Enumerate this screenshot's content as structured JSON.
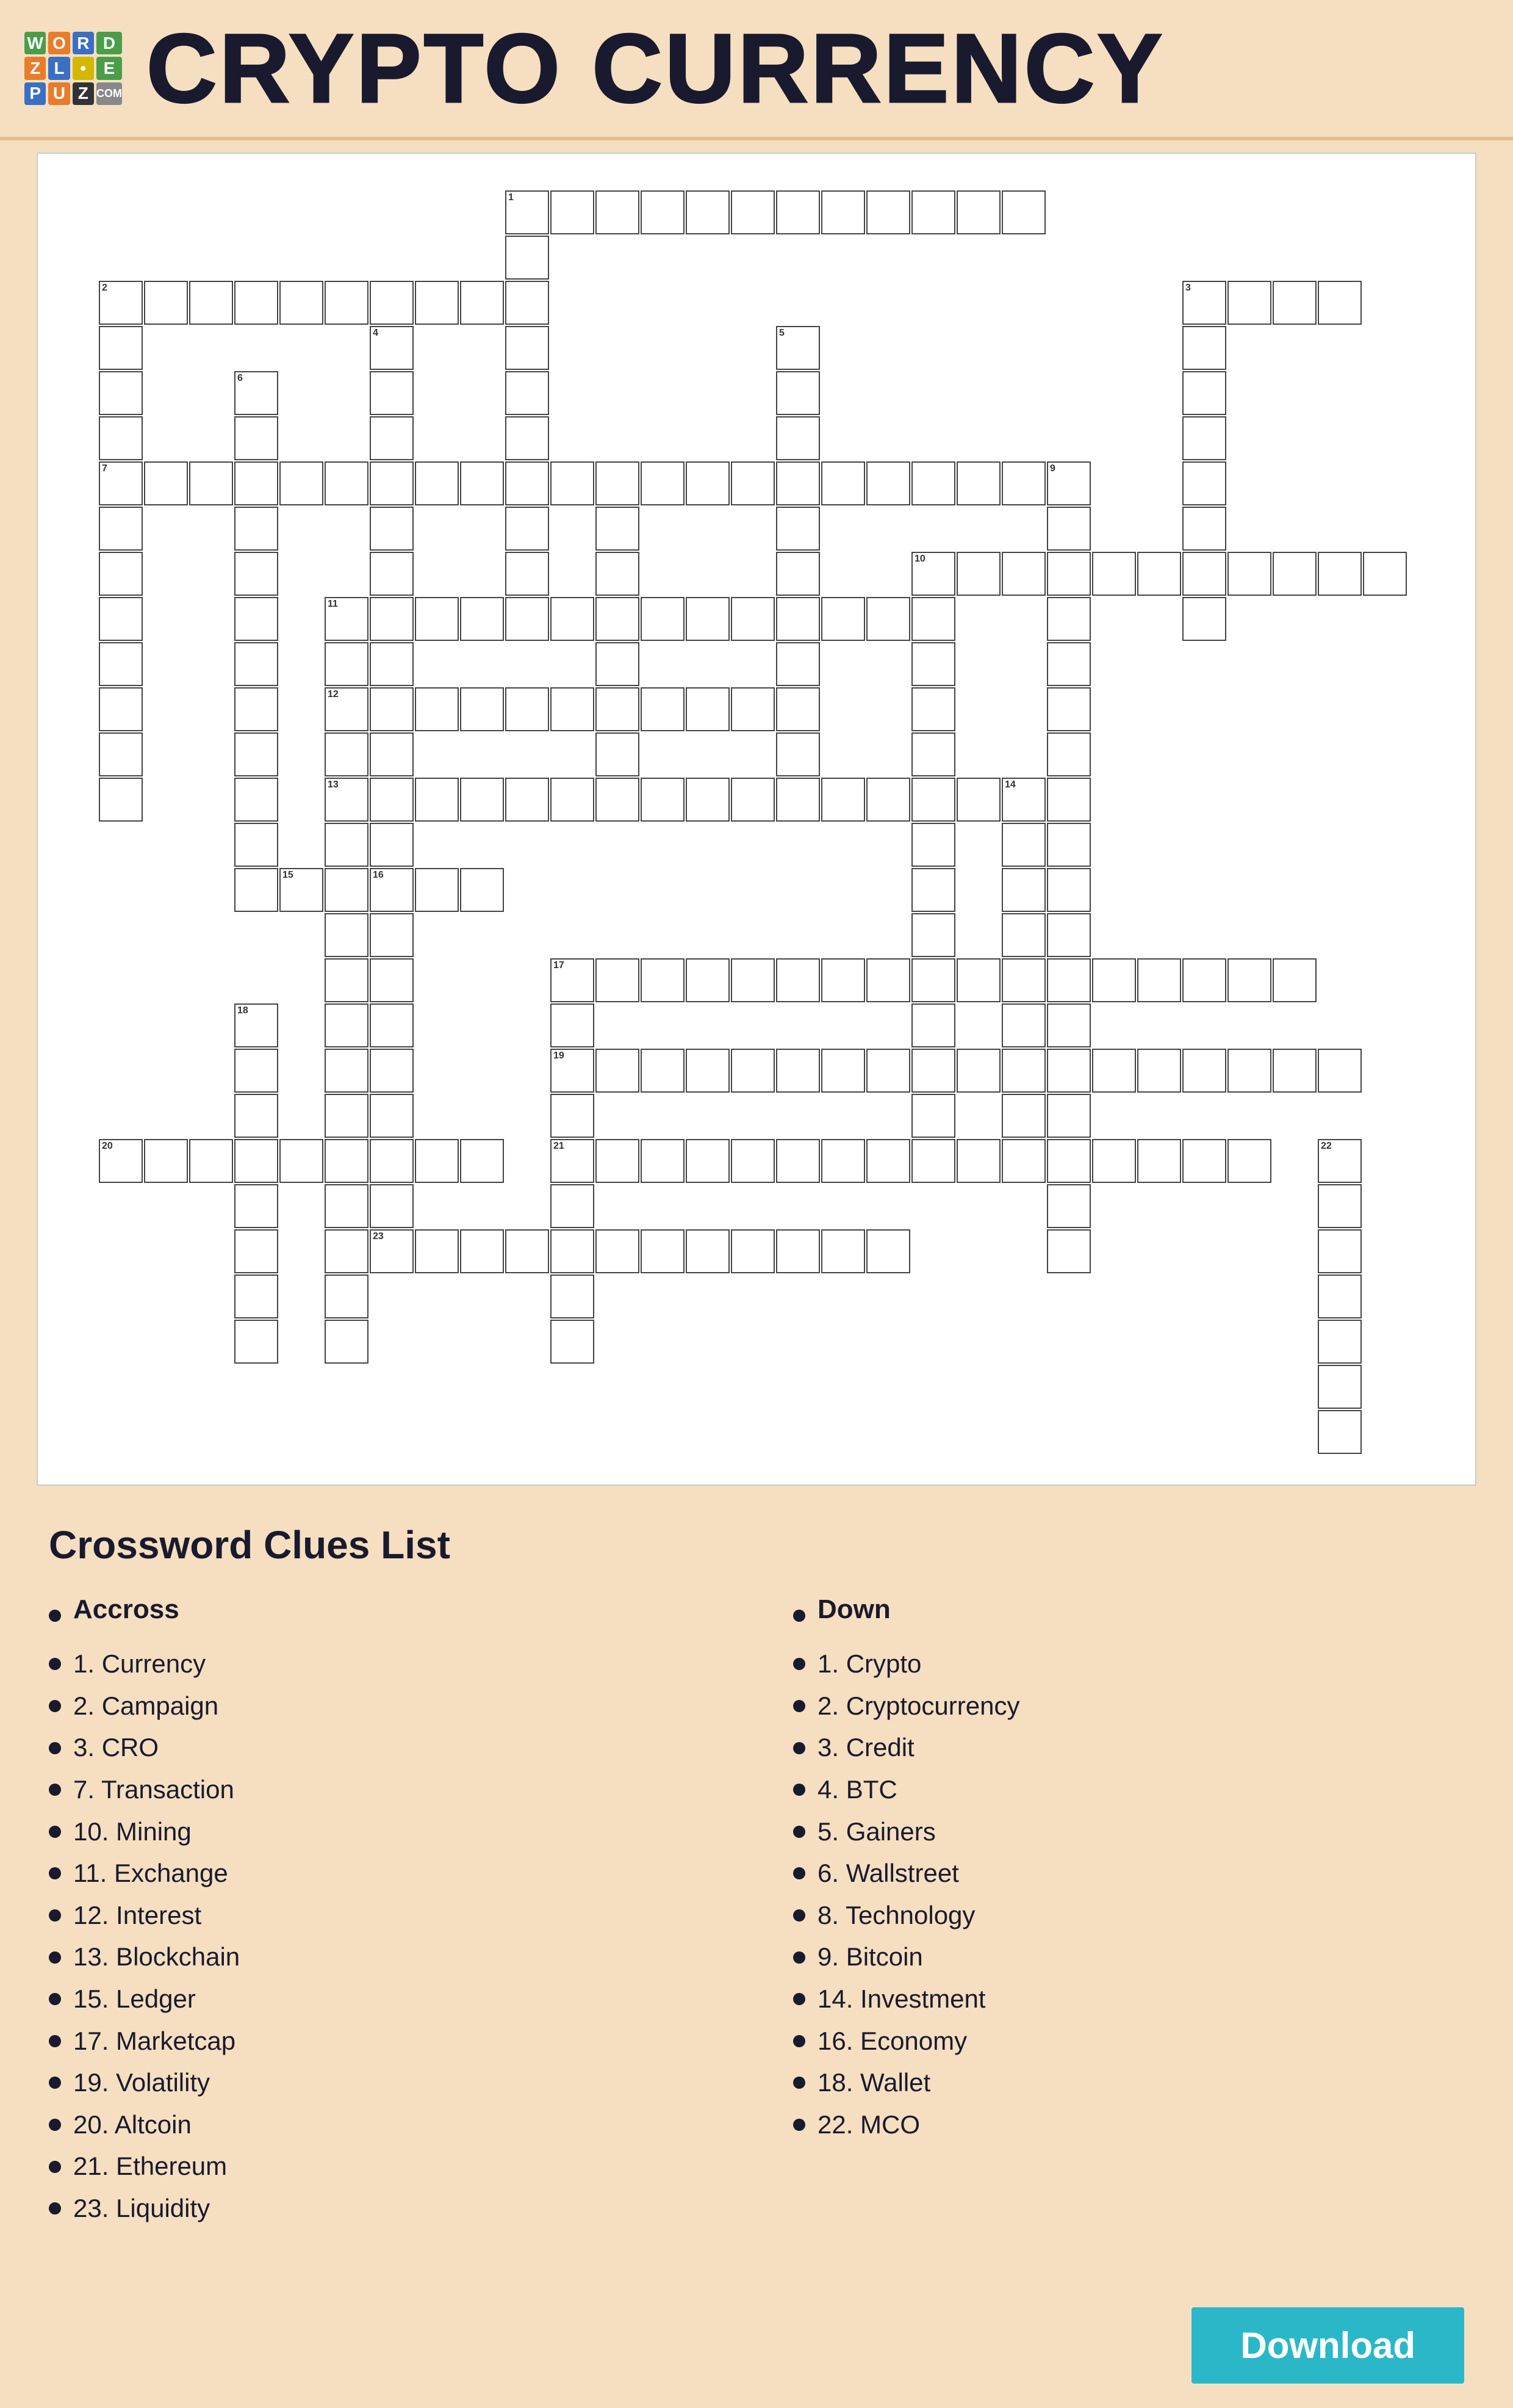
{
  "header": {
    "title": "CRYPTO CURRENCY",
    "logo_letters": [
      "W",
      "O",
      "R",
      "D",
      "P",
      "U",
      "Z",
      "Z",
      "L",
      "E",
      ".",
      "C",
      "O",
      "M"
    ]
  },
  "clues": {
    "section_title": "Crossword Clues List",
    "across_label": "Accross",
    "down_label": "Down",
    "across_items": [
      "1. Currency",
      "2. Campaign",
      "3. CRO",
      "7. Transaction",
      "10. Mining",
      "11. Exchange",
      "12. Interest",
      "13. Blockchain",
      "15. Ledger",
      "17. Marketcap",
      "19. Volatility",
      "20. Altcoin",
      "21. Ethereum",
      "23. Liquidity"
    ],
    "down_items": [
      "1. Crypto",
      "2. Cryptocurrency",
      "3. Credit",
      "4. BTC",
      "5. Gainers",
      "6. Wallstreet",
      "8. Technology",
      "9. Bitcoin",
      "14. Investment",
      "16. Economy",
      "18. Wallet",
      "22. MCO"
    ]
  },
  "download_label": "Download"
}
